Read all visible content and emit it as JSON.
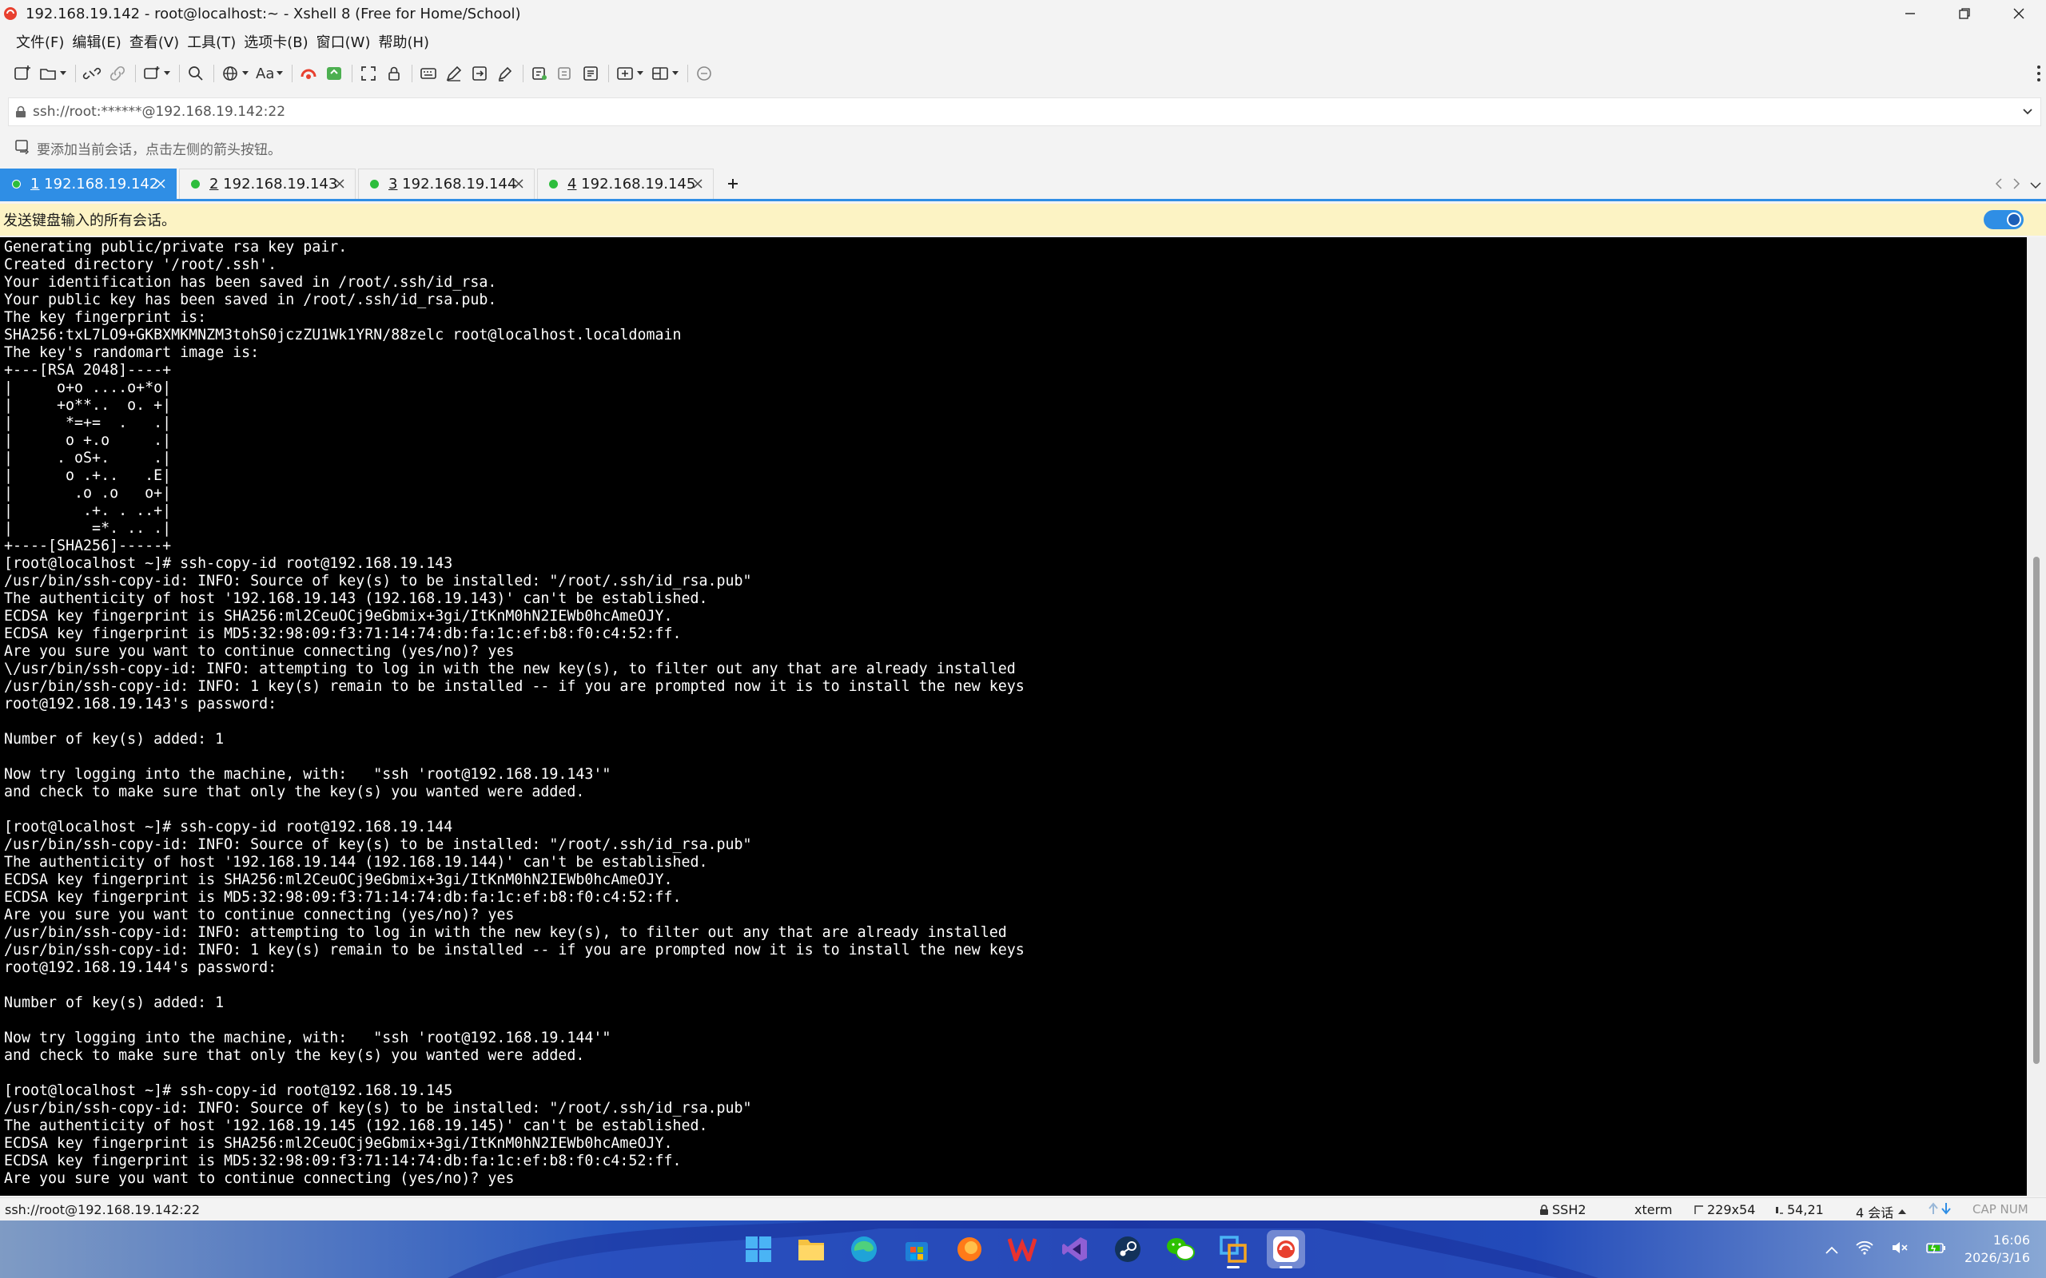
{
  "window": {
    "title": "192.168.19.142 - root@localhost:~ - Xshell 8 (Free for Home/School)"
  },
  "menu": [
    "文件(F)",
    "编辑(E)",
    "查看(V)",
    "工具(T)",
    "选项卡(B)",
    "窗口(W)",
    "帮助(H)"
  ],
  "toolbar": {
    "font_label": "Aa"
  },
  "address": {
    "value": "ssh://root:******@192.168.19.142:22"
  },
  "hint": {
    "text": "要添加当前会话，点击左侧的箭头按钮。"
  },
  "tabs": [
    {
      "num": "1",
      "label": " 192.168.19.142",
      "status": "connected"
    },
    {
      "num": "2",
      "label": " 192.168.19.143",
      "status": "connected"
    },
    {
      "num": "3",
      "label": " 192.168.19.144",
      "status": "connected"
    },
    {
      "num": "4",
      "label": " 192.168.19.145",
      "status": "connected"
    }
  ],
  "broadcast": {
    "text": "发送键盘输入的所有会话。"
  },
  "terminal": {
    "lines": [
      "Generating public/private rsa key pair.",
      "Created directory '/root/.ssh'.",
      "Your identification has been saved in /root/.ssh/id_rsa.",
      "Your public key has been saved in /root/.ssh/id_rsa.pub.",
      "The key fingerprint is:",
      "SHA256:txL7LO9+GKBXMKMNZM3tohS0jczZU1Wk1YRN/88zelc root@localhost.localdomain",
      "The key's randomart image is:",
      "+---[RSA 2048]----+",
      "|     o+o ....o+*o|",
      "|     +o**..  o. +|",
      "|      *=+=  .   .|",
      "|      o +.o     .|",
      "|     . oS+.     .|",
      "|      o .+..   .E|",
      "|       .o .o   o+|",
      "|        .+. . ..+|",
      "|         =*. .. .|",
      "+----[SHA256]-----+",
      "[root@localhost ~]# ssh-copy-id root@192.168.19.143",
      "/usr/bin/ssh-copy-id: INFO: Source of key(s) to be installed: \"/root/.ssh/id_rsa.pub\"",
      "The authenticity of host '192.168.19.143 (192.168.19.143)' can't be established.",
      "ECDSA key fingerprint is SHA256:ml2CeuOCj9eGbmix+3gi/ItKnM0hN2IEWb0hcAmeOJY.",
      "ECDSA key fingerprint is MD5:32:98:09:f3:71:14:74:db:fa:1c:ef:b8:f0:c4:52:ff.",
      "Are you sure you want to continue connecting (yes/no)? yes",
      "\\/usr/bin/ssh-copy-id: INFO: attempting to log in with the new key(s), to filter out any that are already installed",
      "/usr/bin/ssh-copy-id: INFO: 1 key(s) remain to be installed -- if you are prompted now it is to install the new keys",
      "root@192.168.19.143's password:",
      "",
      "Number of key(s) added: 1",
      "",
      "Now try logging into the machine, with:   \"ssh 'root@192.168.19.143'\"",
      "and check to make sure that only the key(s) you wanted were added.",
      "",
      "[root@localhost ~]# ssh-copy-id root@192.168.19.144",
      "/usr/bin/ssh-copy-id: INFO: Source of key(s) to be installed: \"/root/.ssh/id_rsa.pub\"",
      "The authenticity of host '192.168.19.144 (192.168.19.144)' can't be established.",
      "ECDSA key fingerprint is SHA256:ml2CeuOCj9eGbmix+3gi/ItKnM0hN2IEWb0hcAmeOJY.",
      "ECDSA key fingerprint is MD5:32:98:09:f3:71:14:74:db:fa:1c:ef:b8:f0:c4:52:ff.",
      "Are you sure you want to continue connecting (yes/no)? yes",
      "/usr/bin/ssh-copy-id: INFO: attempting to log in with the new key(s), to filter out any that are already installed",
      "/usr/bin/ssh-copy-id: INFO: 1 key(s) remain to be installed -- if you are prompted now it is to install the new keys",
      "root@192.168.19.144's password:",
      "",
      "Number of key(s) added: 1",
      "",
      "Now try logging into the machine, with:   \"ssh 'root@192.168.19.144'\"",
      "and check to make sure that only the key(s) you wanted were added.",
      "",
      "[root@localhost ~]# ssh-copy-id root@192.168.19.145",
      "/usr/bin/ssh-copy-id: INFO: Source of key(s) to be installed: \"/root/.ssh/id_rsa.pub\"",
      "The authenticity of host '192.168.19.145 (192.168.19.145)' can't be established.",
      "ECDSA key fingerprint is SHA256:ml2CeuOCj9eGbmix+3gi/ItKnM0hN2IEWb0hcAmeOJY.",
      "ECDSA key fingerprint is MD5:32:98:09:f3:71:14:74:db:fa:1c:ef:b8:f0:c4:52:ff.",
      "Are you sure you want to continue connecting (yes/no)? yes"
    ]
  },
  "status": {
    "connection": "ssh://root@192.168.19.142:22",
    "protocol": "SSH2",
    "terminal_type": "xterm",
    "size": "229x54",
    "cursor": "54,21",
    "sessions": "4 会话",
    "caps": "CAP NUM"
  },
  "taskbar": {
    "time": "16:06",
    "date": "2026/3/16"
  },
  "colors": {
    "accent": "#2f8ee5",
    "connected": "#2dbd3d",
    "broadcast_bg": "#fcf3c4"
  }
}
